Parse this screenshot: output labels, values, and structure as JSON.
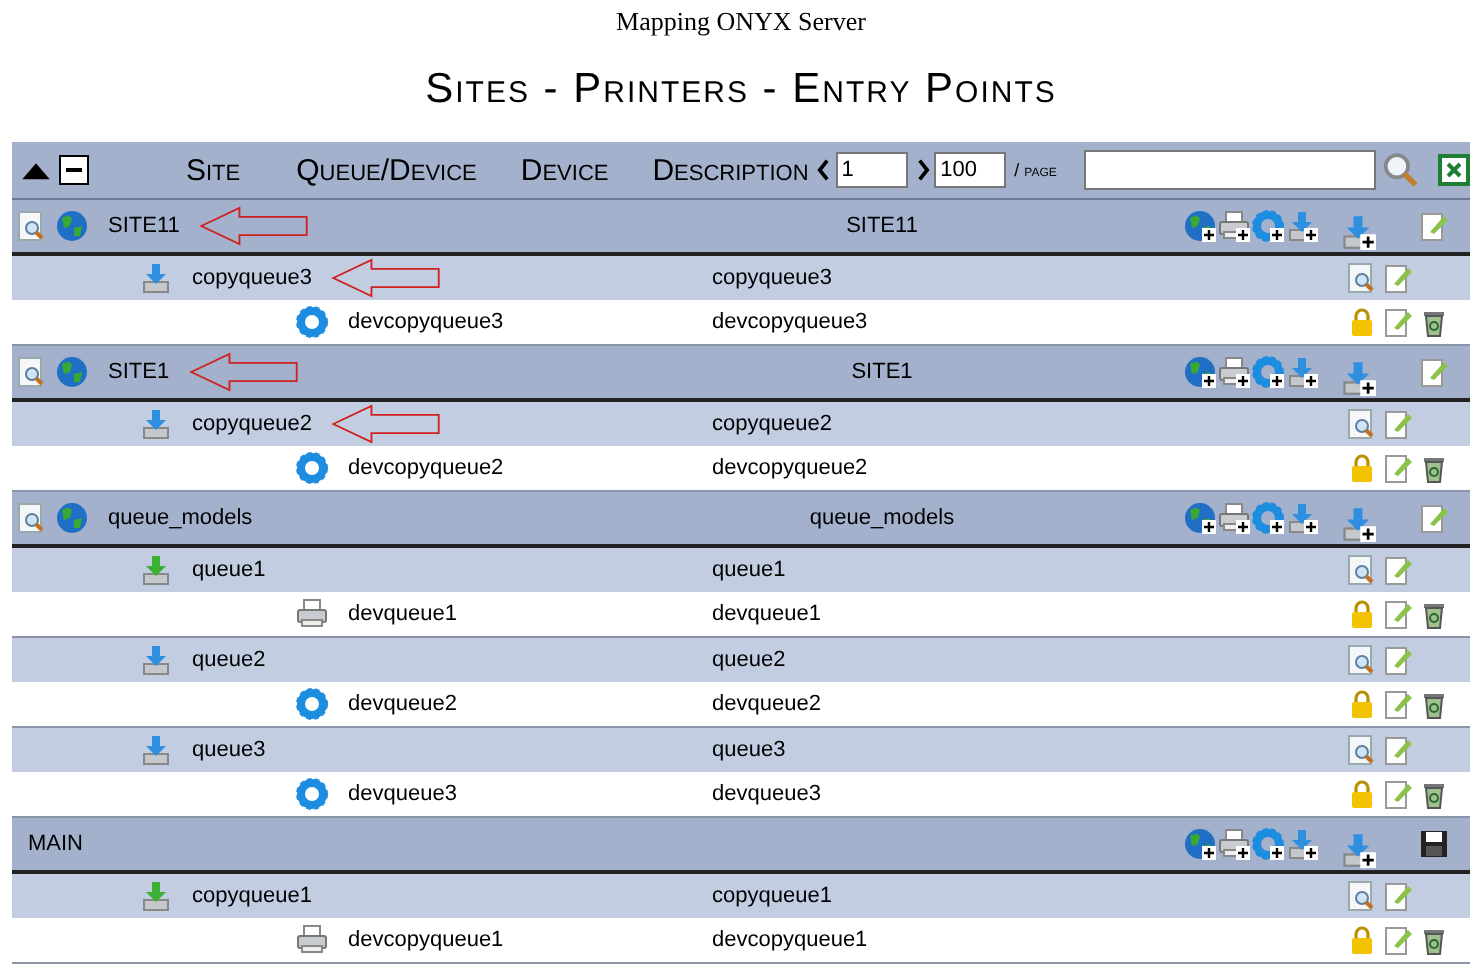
{
  "page_title": "Mapping ONYX Server",
  "heading": "Sites - Printers - Entry Points",
  "columns": [
    "Site",
    "Queue/Device",
    "Device",
    "Description"
  ],
  "pager": {
    "from": "1",
    "count": "100",
    "unit": "/ page"
  },
  "sites": [
    {
      "kind": "site",
      "name": "SITE11",
      "description": "SITE11",
      "annotated": true,
      "children": [
        {
          "kind": "queue",
          "name": "copyqueue3",
          "description": "copyqueue3",
          "annotated": true,
          "children": [
            {
              "kind": "virtual",
              "name": "devcopyqueue3",
              "description": "devcopyqueue3"
            }
          ]
        }
      ]
    },
    {
      "kind": "site",
      "name": "SITE1",
      "description": "SITE1",
      "annotated": true,
      "children": [
        {
          "kind": "queue",
          "name": "copyqueue2",
          "description": "copyqueue2",
          "annotated": true,
          "children": [
            {
              "kind": "virtual",
              "name": "devcopyqueue2",
              "description": "devcopyqueue2"
            }
          ]
        }
      ]
    },
    {
      "kind": "site",
      "name": "queue_models",
      "description": "queue_models",
      "annotated": false,
      "children": [
        {
          "kind": "default",
          "name": "queue1",
          "description": "queue1",
          "annotated": false,
          "children": [
            {
              "kind": "printer",
              "name": "devqueue1",
              "description": "devqueue1"
            }
          ]
        },
        {
          "kind": "queue",
          "name": "queue2",
          "description": "queue2",
          "annotated": false,
          "children": [
            {
              "kind": "virtual",
              "name": "devqueue2",
              "description": "devqueue2"
            }
          ]
        },
        {
          "kind": "queue",
          "name": "queue3",
          "description": "queue3",
          "annotated": false,
          "children": [
            {
              "kind": "virtual",
              "name": "devqueue3",
              "description": "devqueue3"
            }
          ]
        }
      ]
    },
    {
      "kind": "main",
      "name": "MAIN",
      "annotated": false,
      "children": [
        {
          "kind": "default",
          "name": "copyqueue1",
          "description": "copyqueue1",
          "annotated": false,
          "children": [
            {
              "kind": "printer",
              "name": "devcopyqueue1",
              "description": "devcopyqueue1"
            }
          ]
        }
      ]
    }
  ]
}
